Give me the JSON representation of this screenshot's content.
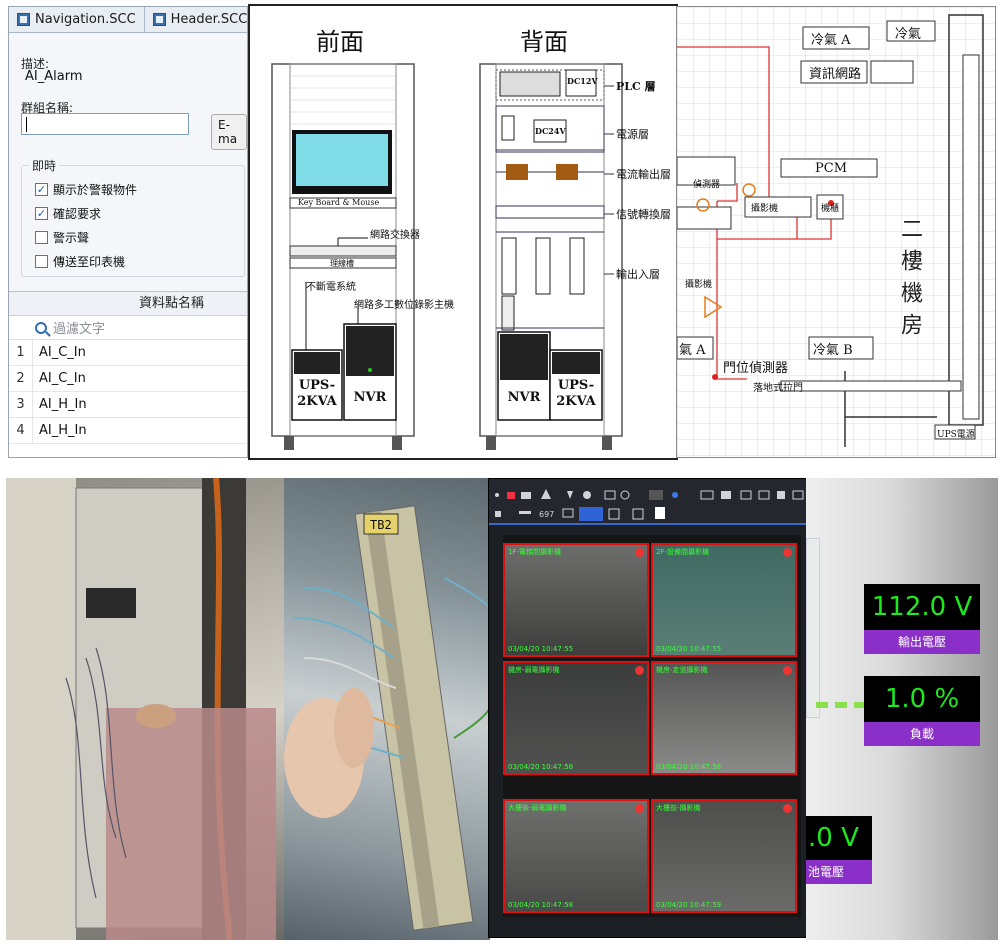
{
  "editor": {
    "tabs": [
      "Navigation.SCC",
      "Header.SCC"
    ],
    "description_label": "描述:",
    "description_value": "AI_Alarm",
    "group_name_label": "群組名稱:",
    "email_button": "E-ma",
    "realtime_group_title": "即時",
    "checkboxes": [
      {
        "label": "顯示於警報物件",
        "checked": true
      },
      {
        "label": "確認要求",
        "checked": true
      },
      {
        "label": "警示聲",
        "checked": false
      },
      {
        "label": "傳送至印表機",
        "checked": false
      }
    ],
    "grid_header": "資料點名稱",
    "filter_placeholder": "過濾文字",
    "rows": [
      {
        "num": "1",
        "value": "AI_C_In"
      },
      {
        "num": "2",
        "value": "AI_C_In"
      },
      {
        "num": "3",
        "value": "AI_H_In"
      },
      {
        "num": "4",
        "value": "AI_H_In"
      }
    ]
  },
  "rack": {
    "front_title": "前面",
    "back_title": "背面",
    "keyboard_label": "Key Board & Mouse",
    "switch_label": "網路交換器",
    "patch_label": "理線槽",
    "ups_system_label": "不斷電系統",
    "nvr_host_label": "網路多工數位錄影主機",
    "ups_box": "UPS-\n2KVA",
    "nvr_box": "NVR",
    "dc12": "DC12V",
    "dc24": "DC24V",
    "layers": [
      "PLC 層",
      "電源層",
      "電流輸出層",
      "信號轉換層",
      "輸出入層"
    ]
  },
  "floor": {
    "ac_a_top": "冷氣 A",
    "ac_top_right": "冷氣",
    "network": "資訊網路",
    "pcm": "PCM",
    "room_label": "二樓機房",
    "ac_b": "冷氣 B",
    "ac_a_bottom": "氣 A",
    "door_detector": "門位偵測器",
    "door_type": "落地式拉門",
    "ups_power": "UPS電源",
    "sensor_label": "偵測器",
    "camera_label": "攝影機",
    "cabinet_label": "機櫃"
  },
  "nvr": {
    "toolbar_count": "697",
    "cameras": [
      {
        "label": "1F-電梯間攝影機",
        "time": "03/04/20 10:47:55"
      },
      {
        "label": "2F-設備間攝影機",
        "time": "03/04/20 10:47:55"
      },
      {
        "label": "機房-弱電攝影機",
        "time": "03/04/20 10:47:58"
      },
      {
        "label": "機房-走道攝影機",
        "time": "03/04/20 10:47:58"
      },
      {
        "label": "大樓後-弱電攝影機",
        "time": "03/04/20 10:47:58"
      },
      {
        "label": "大樓前-攝影機",
        "time": "03/04/20 10:47:59"
      }
    ]
  },
  "meters": {
    "output_voltage_value": "112.0 V",
    "output_voltage_label": "輸出電壓",
    "load_value": "1.0 %",
    "load_label": "負載",
    "partial_value": ".0 V",
    "partial_label": "池電壓"
  },
  "photos": {
    "terminal_label": "TB2"
  }
}
